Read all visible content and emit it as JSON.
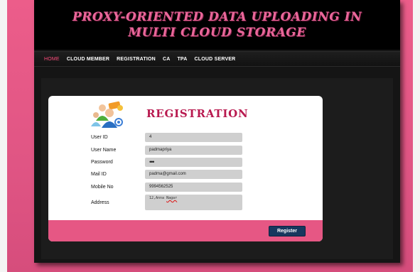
{
  "header": {
    "title_line1": "PROXY-ORIENTED DATA UPLOADING IN",
    "title_line2": "MULTI CLOUD STORAGE"
  },
  "nav": {
    "items": [
      {
        "label": "HOME",
        "active": true
      },
      {
        "label": "CLOUD MEMBER",
        "active": false
      },
      {
        "label": "REGISTRATION",
        "active": false
      },
      {
        "label": "CA",
        "active": false
      },
      {
        "label": "TPA",
        "active": false
      },
      {
        "label": "CLOUD SERVER",
        "active": false
      }
    ]
  },
  "form": {
    "heading": "REGISTRATION",
    "logo_icon": "users-group-icon",
    "fields": [
      {
        "label": "User ID",
        "value": "4"
      },
      {
        "label": "User Name",
        "value": "padmapriya"
      },
      {
        "label": "Password",
        "value": "•••"
      },
      {
        "label": "Mail ID",
        "value": "padma@gmail.com"
      },
      {
        "label": "Mobile No",
        "value": "9994562525"
      },
      {
        "label": "Address",
        "value_prefix": "12,Anna ",
        "value_underlined": "Nagar"
      }
    ],
    "submit_label": "Register"
  },
  "colors": {
    "brand_pink": "#e9679a",
    "heading_red": "#b8194f",
    "button_navy": "#17375e",
    "footer_pink": "#e65784"
  }
}
